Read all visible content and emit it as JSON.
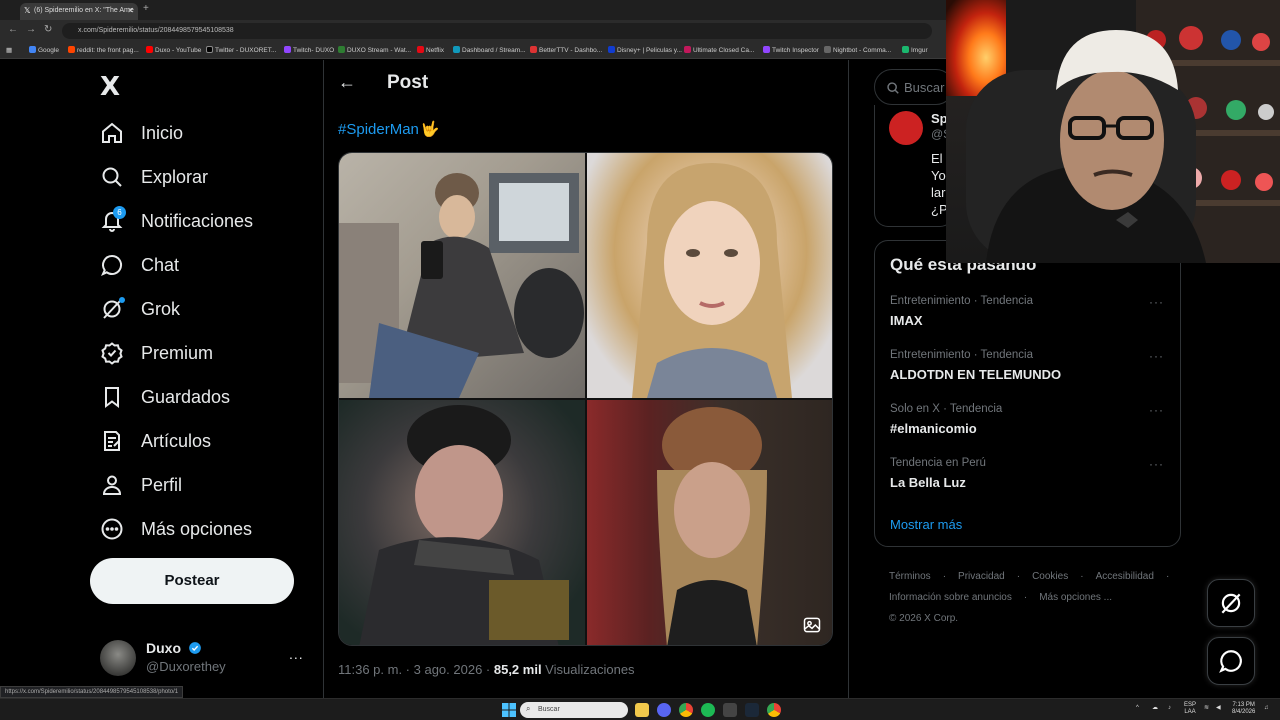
{
  "browser": {
    "tab_title": "(6) Spideremilio en X: \"The Ame",
    "url": "x.com/Spideremilio/status/2084498579545108538",
    "status_url": "https://x.com/Spideremilio/status/2084498579545108538/photo/1",
    "bookmarks": [
      "Google",
      "reddit: the front pag...",
      "Duxo - YouTube",
      "Twitter - DUXORET...",
      "Twitch- DUXO",
      "DUXO Stream - Wat...",
      "Netflix",
      "Dashboard / Stream...",
      "BetterTTV - Dashbo...",
      "Disney+ | Peliculas y...",
      "Ultimate Closed Ca...",
      "Twitch Inspector",
      "Nightbot - Comma...",
      "Imgur"
    ]
  },
  "nav": {
    "logo": "X",
    "items": [
      {
        "label": "Inicio",
        "icon": "home-icon"
      },
      {
        "label": "Explorar",
        "icon": "search-icon"
      },
      {
        "label": "Notificaciones",
        "icon": "bell-icon",
        "badge": "6"
      },
      {
        "label": "Chat",
        "icon": "chat-icon"
      },
      {
        "label": "Grok",
        "icon": "grok-icon"
      },
      {
        "label": "Premium",
        "icon": "premium-icon"
      },
      {
        "label": "Guardados",
        "icon": "bookmark-icon"
      },
      {
        "label": "Artículos",
        "icon": "articles-icon"
      },
      {
        "label": "Perfil",
        "icon": "person-icon"
      },
      {
        "label": "Más opciones",
        "icon": "more-circle-icon"
      }
    ],
    "post_button": "Postear",
    "account": {
      "name": "Duxo",
      "handle": "@Duxorethey",
      "more": "..."
    }
  },
  "post": {
    "header": "Post",
    "hashtag": "#SpiderMan",
    "timestamp": "11:36 p. m. · 3 ago. 2026 · ",
    "views_count": "85,2 mil",
    "views_label": " Visualizaciones"
  },
  "right": {
    "search_placeholder": "Buscar",
    "who_card": {
      "name": "Sp",
      "handle": "@S",
      "lines": [
        "El",
        "Yo",
        "lar",
        "¿P"
      ]
    },
    "trends_title": "Qué está pasando",
    "trends": [
      {
        "context": "Entretenimiento · Tendencia",
        "name": "IMAX"
      },
      {
        "context": "Entretenimiento · Tendencia",
        "name": "ALDOTDN EN TELEMUNDO"
      },
      {
        "context": "Solo en X · Tendencia",
        "name": "#elmanicomio"
      },
      {
        "context": "Tendencia en Perú",
        "name": "La Bella Luz"
      }
    ],
    "show_more": "Mostrar más",
    "footer": [
      "Términos",
      "Privacidad",
      "Cookies",
      "Accesibilidad",
      "Información sobre anuncios",
      "Más opciones ...",
      "© 2026 X Corp."
    ]
  },
  "taskbar": {
    "search": "Buscar",
    "lang": "ESP",
    "region": "LAA",
    "time": "7:13 PM",
    "date": "8/4/2026"
  },
  "colors": {
    "accent": "#1d9bf0",
    "background": "#000000",
    "border": "#2f3336",
    "muted": "#71767b"
  }
}
